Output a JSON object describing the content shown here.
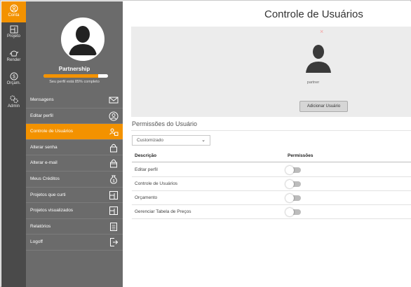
{
  "rail": {
    "items": [
      {
        "label": "Conta",
        "icon": "user-circle-icon",
        "active": true
      },
      {
        "label": "Projeto",
        "icon": "blueprint-icon",
        "active": false
      },
      {
        "label": "Render",
        "icon": "teapot-icon",
        "active": false
      },
      {
        "label": "Orçam.",
        "icon": "coin-icon",
        "active": false
      },
      {
        "label": "Admin",
        "icon": "admin-gears-icon",
        "active": false
      }
    ]
  },
  "profile": {
    "name": "Partnership",
    "progress_percent": 85,
    "progress_text": "Seu perfil está 85% completo"
  },
  "menu": {
    "items": [
      {
        "label": "Mensagens",
        "icon": "envelope-icon"
      },
      {
        "label": "Editar perfil",
        "icon": "profile-edit-icon"
      },
      {
        "label": "Controle de Usuários",
        "icon": "users-control-icon"
      },
      {
        "label": "Alterar senha",
        "icon": "lock-icon"
      },
      {
        "label": "Alterar e-mail",
        "icon": "lock-email-icon"
      },
      {
        "label": "Meus Créditos",
        "icon": "money-bag-icon"
      },
      {
        "label": "Projetos que curti",
        "icon": "blueprint-like-icon"
      },
      {
        "label": "Projetos visualizados",
        "icon": "blueprint-view-icon"
      },
      {
        "label": "Relatórios",
        "icon": "report-icon"
      },
      {
        "label": "Logoff",
        "icon": "logout-icon"
      }
    ],
    "active_index": 2
  },
  "main": {
    "title": "Controle de Usuários",
    "card": {
      "close": "×",
      "user_name": "partner",
      "add_button": "Adicionar Usuário"
    },
    "permissions": {
      "title": "Permissões do Usuário",
      "select_value": "Customizado",
      "col_desc": "Descrição",
      "col_perm": "Permissões",
      "rows": [
        {
          "label": "Editar perfil",
          "enabled": false
        },
        {
          "label": "Controle de Usuários",
          "enabled": false
        },
        {
          "label": "Orçamento",
          "enabled": false
        },
        {
          "label": "Gerenciar Tabela de Preços",
          "enabled": false
        }
      ]
    }
  },
  "colors": {
    "accent": "#f39200",
    "rail": "#4a4a4a",
    "sidebar": "#6b6b6b"
  }
}
